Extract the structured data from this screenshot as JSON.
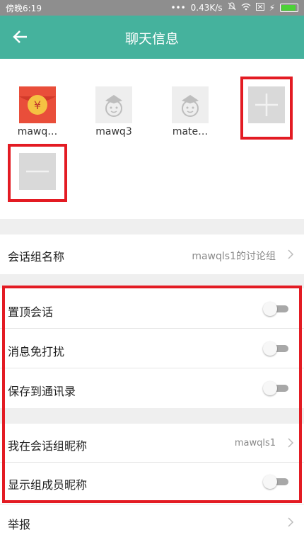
{
  "status_bar": {
    "time": "傍晚6:19",
    "network_speed": "0.43K/s",
    "battery_fill": 0.9
  },
  "header": {
    "title": "聊天信息"
  },
  "members": [
    {
      "name": "mawq…",
      "avatar": "red-envelope-yen-avatar"
    },
    {
      "name": "mawq3",
      "avatar": "default-cartoon-avatar"
    },
    {
      "name": "mate…",
      "avatar": "default-cartoon-avatar"
    }
  ],
  "group_name": {
    "label": "会话组名称",
    "value": "mawqls1的讨论组"
  },
  "settings": [
    {
      "label": "置顶会话",
      "on": false
    },
    {
      "label": "消息免打扰",
      "on": false
    },
    {
      "label": "保存到通讯录",
      "on": false
    }
  ],
  "nickname": {
    "label": "我在会话组昵称",
    "value": "mawqls1"
  },
  "show_nicknames": {
    "label": "显示组成员昵称",
    "on": false
  },
  "report": {
    "label": "举报"
  },
  "colors": {
    "accent": "#45b29d",
    "highlight": "#e31b23",
    "background": "#efefef"
  }
}
